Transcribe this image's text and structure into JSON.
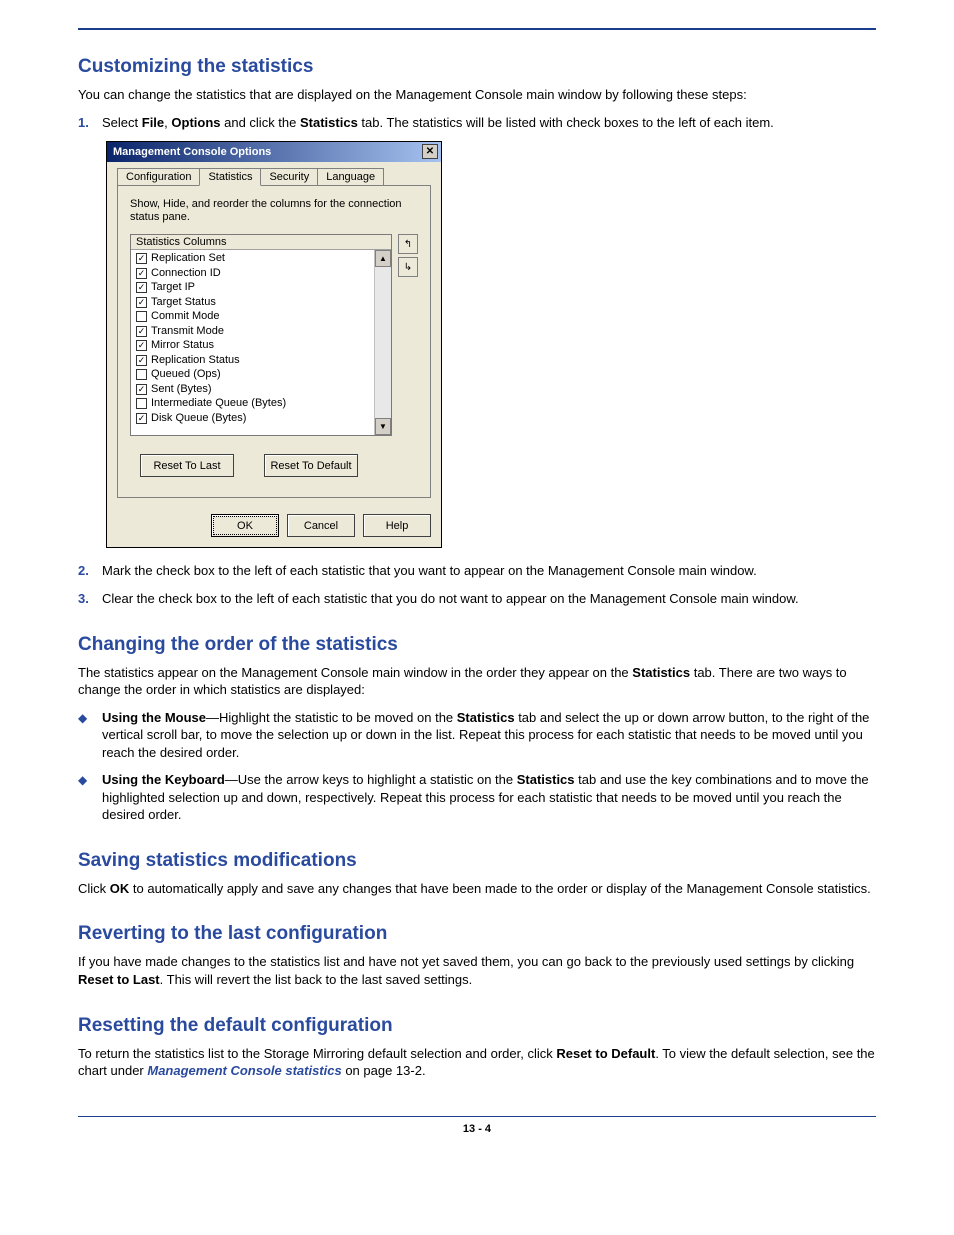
{
  "sections": {
    "customizing": {
      "title": "Customizing the statistics",
      "intro": "You can change the statistics that are displayed on the Management Console main window by following these steps:",
      "step1_pre": "Select ",
      "step1_file": "File",
      "step1_comma": ", ",
      "step1_options": "Options",
      "step1_mid": " and click the ",
      "step1_stats": "Statistics",
      "step1_post": " tab. The statistics will be listed with check boxes to the left of each item.",
      "step2": "Mark the check box to the left of each statistic that you want to appear on the Management Console main window.",
      "step3": "Clear the check box to the left of each statistic that you do not want to appear on the Management Console main window."
    },
    "changing": {
      "title": "Changing the order of the statistics",
      "intro_pre": "The statistics appear on the Management Console main window in the order they appear on the ",
      "intro_stats": "Statistics",
      "intro_post": " tab. There are two ways to change the order in which statistics are displayed:",
      "mouse_label": "Using the Mouse",
      "mouse_text_pre": "—Highlight the statistic to be moved on the ",
      "mouse_text_stats": "Statistics",
      "mouse_text_post": " tab and select the up or down arrow button, to the right of the vertical scroll bar, to move the selection up or down in the list. Repeat this process for each statistic that needs to be moved until you reach the desired order.",
      "kb_label": "Using the Keyboard",
      "kb_text_pre": "—Use the arrow keys to highlight a statistic  on the ",
      "kb_text_stats": "Statistics",
      "kb_text_post": " tab and use the key combinations                               and                                        to move the highlighted selection up and down, respectively. Repeat this process for each statistic that needs to be moved until you reach the desired order."
    },
    "saving": {
      "title": "Saving statistics modifications",
      "text_pre": "Click ",
      "text_ok": "OK",
      "text_post": " to automatically apply and save any changes that have been made to the order or display of the Management Console statistics."
    },
    "reverting": {
      "title": "Reverting to the last configuration",
      "text_pre": "If you have made changes to the statistics list and have not yet saved them, you can go back to the previously used settings by clicking ",
      "text_btn": "Reset to Last",
      "text_post": ". This will revert the list back to the last saved settings."
    },
    "resetting": {
      "title": "Resetting the default configuration",
      "text_pre": "To return the statistics list to the Storage Mirroring default selection and order, click ",
      "text_btn": "Reset to Default",
      "text_mid": ". To view the default selection, see the chart under ",
      "text_link": "Management Console statistics",
      "text_post": " on page 13-2."
    }
  },
  "dialog": {
    "title": "Management Console Options",
    "tabs": [
      "Configuration",
      "Statistics",
      "Security",
      "Language"
    ],
    "instruction": "Show, Hide, and reorder the columns for the connection status pane.",
    "list_header": "Statistics Columns",
    "items": [
      {
        "label": "Replication Set",
        "checked": true
      },
      {
        "label": "Connection ID",
        "checked": true
      },
      {
        "label": "Target IP",
        "checked": true
      },
      {
        "label": "Target Status",
        "checked": true
      },
      {
        "label": "Commit Mode",
        "checked": false
      },
      {
        "label": "Transmit Mode",
        "checked": true
      },
      {
        "label": "Mirror Status",
        "checked": true
      },
      {
        "label": "Replication Status",
        "checked": true
      },
      {
        "label": "Queued (Ops)",
        "checked": false
      },
      {
        "label": "Sent (Bytes)",
        "checked": true
      },
      {
        "label": "Intermediate Queue (Bytes)",
        "checked": false
      },
      {
        "label": "Disk Queue (Bytes)",
        "checked": true
      }
    ],
    "reset_last": "Reset To Last",
    "reset_default": "Reset To Default",
    "ok": "OK",
    "cancel": "Cancel",
    "help": "Help"
  },
  "page_number": "13 - 4"
}
